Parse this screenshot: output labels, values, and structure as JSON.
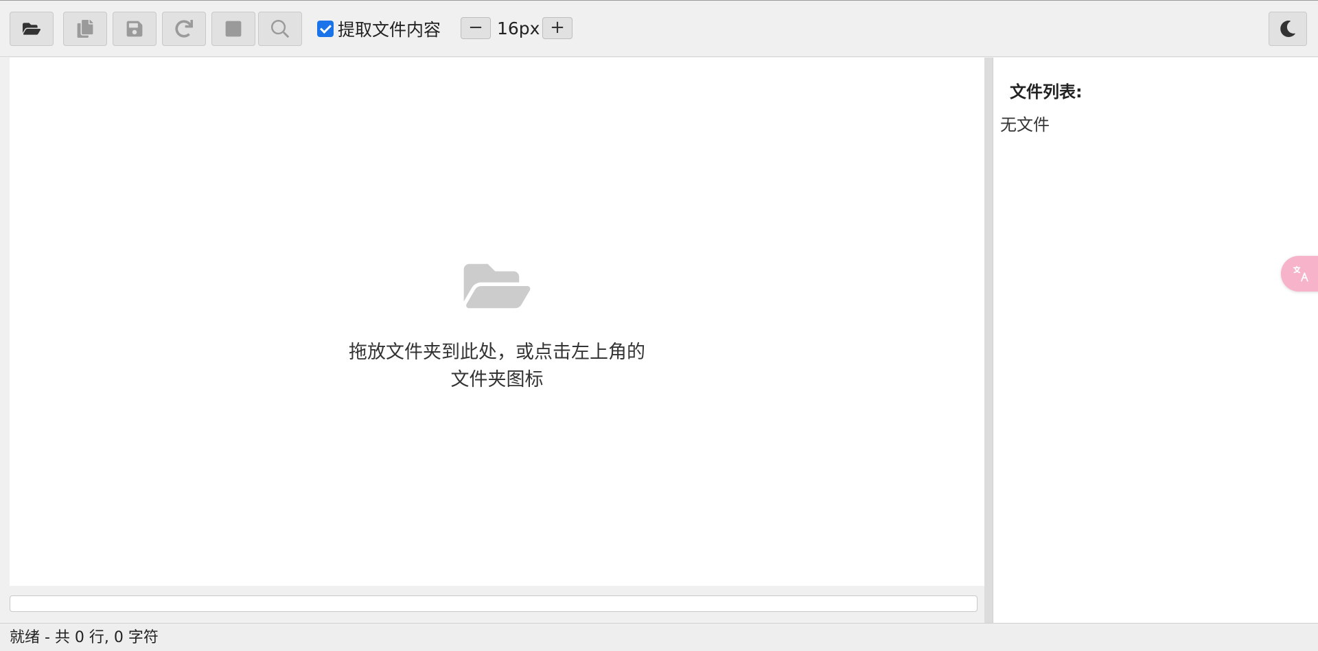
{
  "toolbar": {
    "extract_label": "提取文件内容",
    "extract_checked": true,
    "zoom_minus": "−",
    "zoom_value": "16px",
    "zoom_plus": "+"
  },
  "editor": {
    "drop_line1": "拖放文件夹到此处，或点击左上角的",
    "drop_line2": "文件夹图标"
  },
  "sidebar": {
    "title": "文件列表:",
    "empty": "无文件"
  },
  "status": {
    "text": "就绪 - 共 0 行, 0 字符"
  },
  "icons": {
    "open": "folder-open-icon",
    "copy": "copy-icon",
    "save": "save-icon",
    "refresh": "refresh-icon",
    "stop": "stop-icon",
    "search": "search-icon",
    "theme": "moon-icon",
    "translate": "translate-icon"
  },
  "colors": {
    "accent": "#1a73e8",
    "translate_bubble": "#f7b3c9"
  }
}
